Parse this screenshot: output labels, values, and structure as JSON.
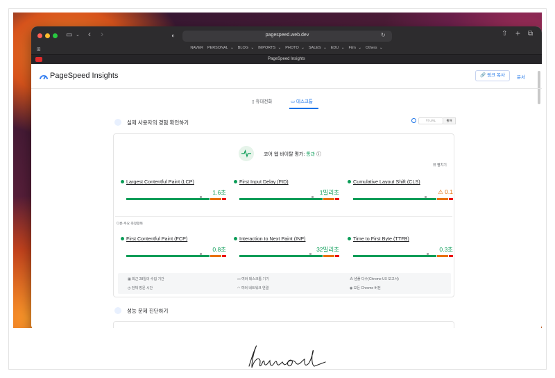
{
  "browser": {
    "url": "pagespeed.web.dev",
    "tab_title": "PageSpeed Insights",
    "bookmarks": [
      "NAVER",
      "PERSONAL ⌄",
      "BLOG ⌄",
      "IMPORTS ⌄",
      "PHOTO ⌄",
      "SALES ⌄",
      "EDU ⌄",
      "Film ⌄",
      "Others ⌄"
    ]
  },
  "header": {
    "title": "PageSpeed Insights",
    "link_button": "링크 복사",
    "docs": "문서"
  },
  "device_tabs": {
    "mobile": "휴대전화",
    "desktop": "데스크톱"
  },
  "field": {
    "title": "실제 사용자의 경험 확인하기",
    "toggle_url": "이 URL",
    "toggle_origin": "출처",
    "cwv_label": "코어 웹 바이탈 평가:",
    "cwv_status": "통과",
    "expand": "뷰 펼치기",
    "other_label": "다른 주요 측정항목"
  },
  "metrics": [
    {
      "name": "Largest Contentful Paint (LCP)",
      "value": "1.6초",
      "status": "good",
      "marker": 0.74
    },
    {
      "name": "First Input Delay (FID)",
      "value": "1밀리초",
      "status": "good",
      "marker": 0.73
    },
    {
      "name": "Cumulative Layout Shift (CLS)",
      "value": "⚠ 0.1",
      "status": "average",
      "marker": 0.72
    },
    {
      "name": "First Contentful Paint (FCP)",
      "value": "0.8초",
      "status": "good",
      "marker": 0.74
    },
    {
      "name": "Interaction to Next Paint (INP)",
      "value": "32밀리초",
      "status": "good",
      "marker": 0.71
    },
    {
      "name": "Time to First Byte (TTFB)",
      "value": "0.3초",
      "status": "good",
      "marker": 0.74
    }
  ],
  "footer": {
    "a1": "최근 28일의 수집 기간",
    "a2": "여러 데스크톱 기기",
    "a3": "샘플 다수(Chrome UX 보고서)",
    "b1": "전체 방문 시간",
    "b2": "여러 네트워크 연결",
    "b3": "모든 Chrome 버전"
  },
  "diagnose": {
    "title": "성능 문제 진단하기"
  },
  "signature": "hiwood",
  "colors": {
    "good": "#0c9d58",
    "average": "#e8710a",
    "poor": "#eb0f00",
    "accent": "#1a73e8"
  }
}
